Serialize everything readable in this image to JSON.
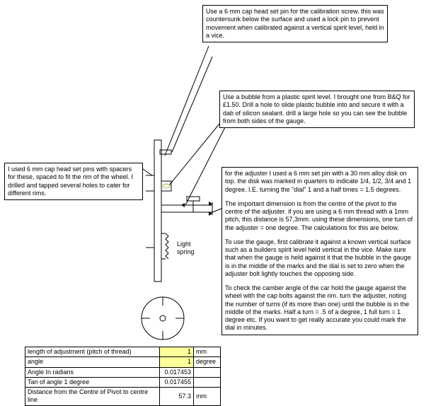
{
  "callouts": {
    "topRight": "Use a 6 mm cap head set pin for the calibration screw.  this was countersunk below the surface and used a lock pin to prevent movement when calibrated against a vertical spirit level, held in a vice.",
    "bubble": "Use a bubble from a plastic spirit level.  I brought one from B&Q for £1.50. Drill a hole to slide plastic bubble into and secure it with a dab of silicon sealant.  drill a large hole so you can see the bubble from both sides of the gauge.",
    "left": "I used 6 mm cap head set pins with spacers for these, spaced to fit the rim of the wheel.  I drilled and tapped several holes to cater for different rims."
  },
  "textblock": {
    "p1": "for the adjuster I used a 6 mm set pin with a 30 mm alloy disk on top.  the disk was marked in quarters to indicate 1/4, 1/2, 3/4 and 1 degree.  I.E. turning the \"dial\" 1 and a half times = 1.5 degrees.",
    "p2": "The important dimension is from the centre of the pivot to the centre of the adjuster.  if you are using a 6 mm thread with a 1mm pitch, this distance is 57.3mm.  using these dimensions, one turn of the adjuster = one degree.  The calculations for this are below.",
    "p3": "To use the gauge, first calibrate it against a known vertical surface such as a builders spirit level held vertical in the vice.  Make sure that when the gauge is held against it that the bubble in the gauge is in the middle of the marks and the dial is set to zero when the adjuster bolt lightly touches the opposing side.",
    "p4": "To check the camber angle of the car hold the gauge against the wheel with the cap bolts against the rim.  turn the adjuster, noting the number of turns (if its more than one) until the bubble is in the middle of the marks.  Half a turn = .5 of a degree, 1 full turn = 1 degree etc.  If you want to get really accurate you could mark the dial in minutes."
  },
  "labels": {
    "lightSpring": "Light spring"
  },
  "table": {
    "r1": {
      "label": "length of adjustment (pitch of thread)",
      "val": "1",
      "unit": "mm"
    },
    "r2": {
      "label": "angle",
      "val": "1",
      "unit": "degree"
    },
    "r3": {
      "label": "Angle In radians",
      "val": "0.017453",
      "unit": ""
    },
    "r4": {
      "label": "Tan of angle 1 degree",
      "val": "0.017455",
      "unit": ""
    },
    "r5": {
      "label": "Distance from the Centre of Pivot to centre line",
      "val": "57.3",
      "unit": "mm"
    }
  }
}
